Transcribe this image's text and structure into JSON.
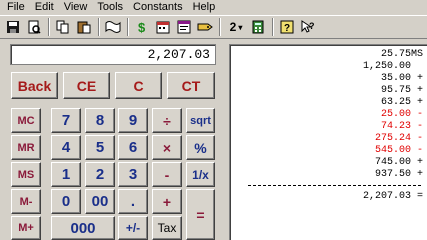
{
  "menu": [
    "File",
    "Edit",
    "View",
    "Tools",
    "Constants",
    "Help"
  ],
  "toolbar": {
    "decimals_value": "2",
    "icons": [
      "save-icon",
      "print-preview-icon",
      "copy-icon",
      "paste-icon",
      "tape-icon",
      "currency-icon",
      "calendar-icon",
      "tag-icon",
      "decimals-dropdown-icon",
      "calculator-icon",
      "help-icon",
      "context-help-icon"
    ]
  },
  "display": {
    "value": "2,207.03"
  },
  "buttons": {
    "back": "Back",
    "ce": "CE",
    "c": "C",
    "ct": "CT",
    "mc": "MC",
    "mr": "MR",
    "ms": "MS",
    "mminus": "M-",
    "mplus": "M+",
    "d7": "7",
    "d8": "8",
    "d9": "9",
    "div": "÷",
    "sqrt": "sqrt",
    "d4": "4",
    "d5": "5",
    "d6": "6",
    "mul": "×",
    "pct": "%",
    "d1": "1",
    "d2": "2",
    "d3": "3",
    "minus": "-",
    "inv": "1/x",
    "d0": "0",
    "d00": "00",
    "dot": ".",
    "plus": "+",
    "equals": "=",
    "d000": "000",
    "plusminus": "+/-",
    "tax": "Tax"
  },
  "tape": {
    "entries": [
      {
        "value": "25.75",
        "op": "MS",
        "color": "#000000"
      },
      {
        "value": "1,250.00",
        "op": "",
        "color": "#000000"
      },
      {
        "value": "35.00",
        "op": "+",
        "color": "#000000"
      },
      {
        "value": "95.75",
        "op": "+",
        "color": "#000000"
      },
      {
        "value": "63.25",
        "op": "+",
        "color": "#000000"
      },
      {
        "value": "25.00",
        "op": "-",
        "color": "#e00000"
      },
      {
        "value": "74.23",
        "op": "-",
        "color": "#e00000"
      },
      {
        "value": "275.24",
        "op": "-",
        "color": "#e00000"
      },
      {
        "value": "545.00",
        "op": "-",
        "color": "#e00000"
      },
      {
        "value": "745.00",
        "op": "+",
        "color": "#000000"
      },
      {
        "value": "937.50",
        "op": "+",
        "color": "#000000"
      }
    ],
    "total": {
      "value": "2,207.03",
      "op": "=",
      "color": "#000000"
    }
  }
}
